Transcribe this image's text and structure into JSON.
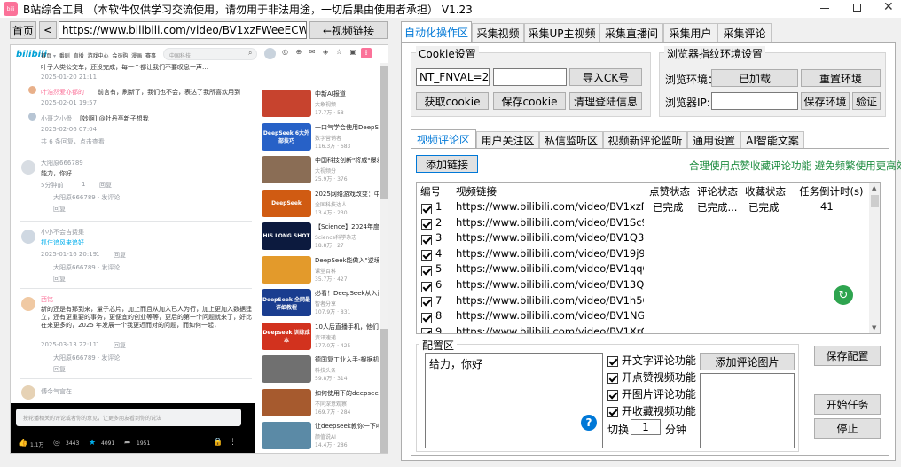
{
  "app": {
    "title": "B站综合工具 （本软件仅供学习交流使用，请勿用于非法用途，一切后果由使用者承担）  V1.23",
    "controls": [
      "minimize",
      "maximize",
      "close"
    ]
  },
  "browser": {
    "home_label": "首页",
    "back_label": "<",
    "url": "https://www.bilibili.com/video/BV1xzFWeeECW/?vd_source",
    "video_link_label": "←视频链接",
    "page": {
      "logo": "bilibili",
      "nav": [
        "首页",
        "番剧",
        "直播",
        "游戏中心",
        "会员购",
        "漫画",
        "赛事"
      ],
      "search_placeholder": "中国科技",
      "comments": [
        {
          "text": "叶子人类公交车，还没完成，每一个都让我们不要叹息一声…",
          "date": "2025-01-20 21:11",
          "likes": "",
          "reply": "回复"
        },
        {
          "user": "叶浩然爱亦都的",
          "badge": "UP",
          "text": "前言有，刷新了，我们也不会，表达了我所喜欢用到",
          "date": "2025-02-01 19:57",
          "likes": "",
          "reply": "回复"
        },
        {
          "user": "小哥之小骨",
          "text": "[妙啊] @牡丹亭新子想我",
          "date": "2025-02-06 07:04",
          "likes": "",
          "reply": "回复"
        },
        {
          "more": "共 6 条回复，点击查看"
        },
        {
          "user": "大阳原666789",
          "badge": "LV6",
          "text": "能力，你好",
          "date": "5分钟前",
          "likes": "1",
          "reply": "回复"
        },
        {
          "sub": "大阳原666789 · 发评论",
          "reply": "回复"
        },
        {
          "user": "小小不会吉费集",
          "badge": "LV5",
          "text": "抓住追风来追好",
          "date": "2025-01-16 20:19",
          "likes": "1",
          "reply": "回复"
        },
        {
          "sub": "大阳原666789 · 发评论",
          "reply": "回复"
        },
        {
          "user": "西铭",
          "badge": "LV6",
          "text": "新的还是有那到来，量子芯片，加上而且从加入已人为行，加上更加入数据建立，还有更重要的事务，更便宜的创业等等，更后的第一个问题就来了，好比在来更多的，2025 年发展一个我更近而对的问题，而如何一起，",
          "date": "2025-03-13 22:11",
          "likes": "1",
          "reply": "回复"
        },
        {
          "sub": "大阳原666789 · 发评论",
          "reply": "回复"
        },
        {
          "user": "傅今气宫在",
          "badge": "LV4",
          "text": ""
        }
      ],
      "comment_input_placeholder": "按轮播相关的评论或者你的意见，让更多朋友看到你的说法",
      "bottom_bar": {
        "like": "1.1万",
        "coin": "3443",
        "fav": "4091",
        "share": "1951"
      },
      "recommended": [
        {
          "title": "中新AI报道",
          "meta": "大象视频",
          "views": "17.7万",
          "comments": "58",
          "color": "#c7432e"
        },
        {
          "title": "一口气学会使用DeepSeek,简单的方法实用的技巧",
          "meta": "数字营销者",
          "views": "116.3万",
          "comments": "683",
          "color": "#2761c7"
        },
        {
          "title": "中国科技创新\"将威\"爆发，美国休养并了解",
          "meta": "大视频分",
          "views": "25.9万",
          "comments": "376",
          "color": "#8a6d55"
        },
        {
          "title": "2025网络游戏改变：中国前，要全入全新的运作",
          "meta": "全国科技达人",
          "views": "13.4万",
          "comments": "230",
          "color": "#d05b12"
        },
        {
          "title": "【Science】2024年度十大科学突破",
          "meta": "Science科学杂志",
          "views": "18.8万",
          "comments": "27",
          "color": "#0c1a3e"
        },
        {
          "title": "DeepSeek能做入\"逆境\"发展史",
          "meta": "课堂百科",
          "views": "35.7万",
          "comments": "427",
          "color": "#e39a2b"
        },
        {
          "title": "必看！DeepSeek从入门到精通，这11个神奇技巧，让你...",
          "meta": "智者分享",
          "views": "107.9万",
          "comments": "831",
          "color": "#1a3d8f"
        },
        {
          "title": "10人后直播手机，他们将出peook比体成绩",
          "meta": "资讯速递",
          "views": "177.0万",
          "comments": "425",
          "color": "#d2321e"
        },
        {
          "title": "德国复工业入手-根据机器人搭上东风",
          "meta": "科技头条",
          "views": "59.8万",
          "comments": "314",
          "color": "#707070"
        },
        {
          "title": "如何使用下的deepseek和AI可能",
          "meta": "不同深意观察",
          "views": "169.7万",
          "comments": "284",
          "color": "#a65a2e"
        },
        {
          "title": "让deepseek教你一下吧科技选和题",
          "meta": "颜值说AI",
          "views": "14.4万",
          "comments": "286",
          "color": "#5b8aa6"
        },
        {
          "title": "我将尝试学习 DeepSeek开源精灵，学会 科技前言",
          "meta": "",
          "views": "104.2万",
          "comments": "848",
          "color": "#a9662c"
        }
      ],
      "thumb_labels": [
        "",
        "DeepSeek 6大外部技巧",
        "",
        "DeepSeek",
        "HIS LONG SHOT",
        "",
        "DeepSeek 全网最详细教程",
        "Deepseek 训练成本",
        "",
        "",
        "",
        ""
      ]
    }
  },
  "tabs_main": [
    "自动化操作区",
    "采集视频",
    "采集UP主视频",
    "采集直播间",
    "采集用户",
    "采集评论"
  ],
  "cookie": {
    "title": "Cookie设置",
    "value": "NT_FNVAL=2000;",
    "value2": "",
    "import_label": "导入CK号",
    "get_label": "获取cookie",
    "save_label": "保存cookie",
    "clear_label": "清理登陆信息"
  },
  "fingerprint": {
    "title": "浏览器指纹环境设置",
    "env_label": "浏览环境：",
    "loaded_label": "已加载",
    "reset_label": "重置环境",
    "ip_label": "浏览器IP:",
    "ip_value": "",
    "save_label": "保存环境",
    "verify_label": "验证"
  },
  "sub_tabs": [
    "视频评论区",
    "用户关注区",
    "私信监听区",
    "视频新评论监听",
    "通用设置",
    "AI智能文案"
  ],
  "add_link_label": "添加链接",
  "hint": "合理使用点赞收藏评论功能 避免频繁使用更高效",
  "table": {
    "headers": [
      "编号",
      "视频链接",
      "点赞状态",
      "评论状态",
      "收藏状态",
      "任务倒计时(s)"
    ],
    "rows": [
      {
        "no": "1",
        "url": "https://www.bilibili.com/video/BV1xzFWe...",
        "like": "已完成",
        "comment": "已完成...",
        "fav": "已完成",
        "timer": "41"
      },
      {
        "no": "2",
        "url": "https://www.bilibili.com/video/BV1Sc9sY...",
        "like": "",
        "comment": "",
        "fav": "",
        "timer": ""
      },
      {
        "no": "3",
        "url": "https://www.bilibili.com/video/BV1Q3wX...",
        "like": "",
        "comment": "",
        "fav": "",
        "timer": ""
      },
      {
        "no": "4",
        "url": "https://www.bilibili.com/video/BV19j9AYT...",
        "like": "",
        "comment": "",
        "fav": "",
        "timer": ""
      },
      {
        "no": "5",
        "url": "https://www.bilibili.com/video/BV1qqQ8Y...",
        "like": "",
        "comment": "",
        "fav": "",
        "timer": ""
      },
      {
        "no": "6",
        "url": "https://www.bilibili.com/video/BV13QQ8...",
        "like": "",
        "comment": "",
        "fav": "",
        "timer": ""
      },
      {
        "no": "7",
        "url": "https://www.bilibili.com/video/BV1h5QaY...",
        "like": "",
        "comment": "",
        "fav": "",
        "timer": ""
      },
      {
        "no": "8",
        "url": "https://www.bilibili.com/video/BV1NGQv...",
        "like": "",
        "comment": "",
        "fav": "",
        "timer": ""
      },
      {
        "no": "9",
        "url": "https://www.bilibili.com/video/BV1XrQaY...",
        "like": "",
        "comment": "",
        "fav": "",
        "timer": ""
      }
    ]
  },
  "config": {
    "title": "配置区",
    "comment_text": "给力，你好",
    "opt_text_comment": "开文字评论功能",
    "opt_like": "开点赞视频功能",
    "opt_image_comment": "开图片评论功能",
    "opt_fav": "开收藏视频功能",
    "switch_label": "切换",
    "switch_value": "1",
    "minute_label": "分钟",
    "add_image_label": "添加评论图片",
    "save_config_label": "保存配置",
    "start_label": "开始任务",
    "stop_label": "停止",
    "help": "?"
  }
}
